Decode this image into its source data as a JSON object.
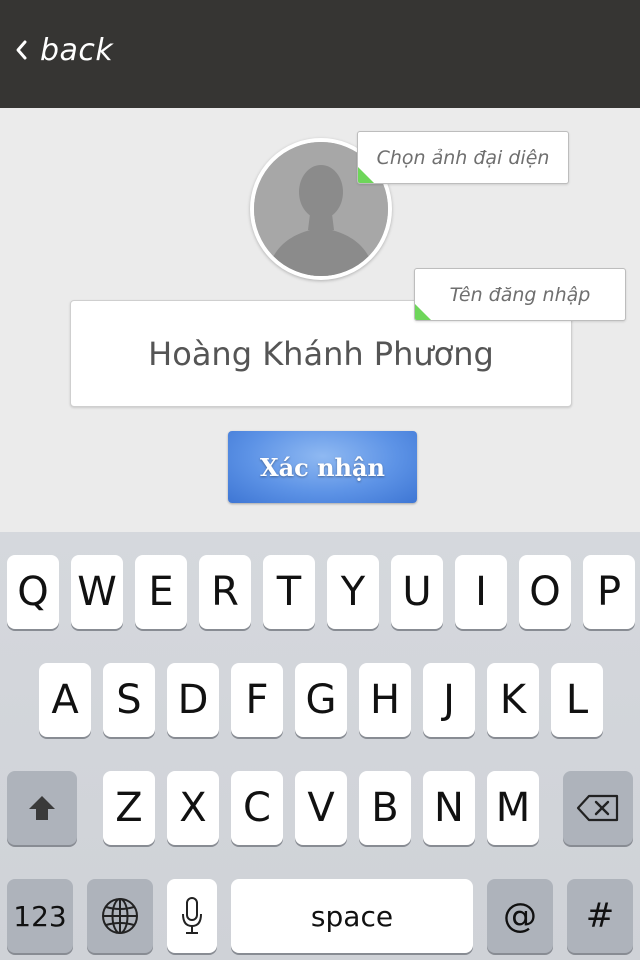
{
  "nav": {
    "back_label": "back"
  },
  "profile": {
    "avatar_hint": "Chọn ảnh đại diện",
    "username_hint": "Tên đăng nhập",
    "username_value": "Hoàng Khánh Phương",
    "confirm_label": "Xác nhận"
  },
  "colors": {
    "topbar": "#363533",
    "background": "#ebebeb",
    "accent_button": "#5d93e6",
    "tooltip_marker": "#6ed65a"
  },
  "keyboard": {
    "row1": [
      "Q",
      "W",
      "E",
      "R",
      "T",
      "Y",
      "U",
      "I",
      "O",
      "P"
    ],
    "row2": [
      "A",
      "S",
      "D",
      "F",
      "G",
      "H",
      "J",
      "K",
      "L"
    ],
    "row3": [
      "Z",
      "X",
      "C",
      "V",
      "B",
      "N",
      "M"
    ],
    "numbers_label": "123",
    "space_label": "space",
    "at_label": "@",
    "hash_label": "#",
    "icons": {
      "shift": "shift-icon",
      "backspace": "backspace-icon",
      "globe": "globe-icon",
      "mic": "microphone-icon"
    }
  }
}
